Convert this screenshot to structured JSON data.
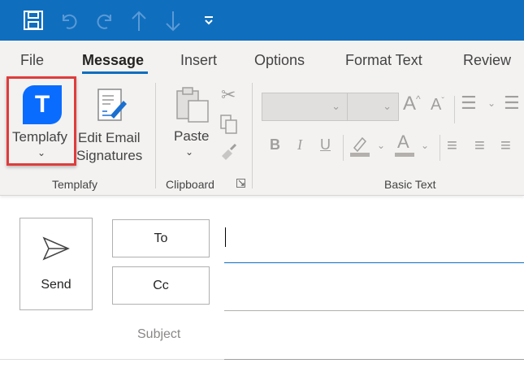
{
  "quick_access": {
    "icons": [
      "save-icon",
      "undo-icon",
      "redo-icon",
      "up-arrow-icon",
      "down-arrow-icon",
      "customize-dropdown-icon"
    ]
  },
  "tabs": [
    {
      "label": "File"
    },
    {
      "label": "Message",
      "active": true
    },
    {
      "label": "Insert"
    },
    {
      "label": "Options"
    },
    {
      "label": "Format Text"
    },
    {
      "label": "Review"
    }
  ],
  "ribbon": {
    "templafy": {
      "button": "Templafy",
      "edit_signatures_line1": "Edit Email",
      "edit_signatures_line2": "Signatures",
      "group": "Templafy",
      "logo_letter": "T"
    },
    "clipboard": {
      "paste": "Paste",
      "group": "Clipboard"
    },
    "basic_text": {
      "group": "Basic Text",
      "bold": "B",
      "italic": "I",
      "underline": "U",
      "font_color": "A"
    }
  },
  "compose": {
    "send": "Send",
    "to": "To",
    "cc": "Cc",
    "subject": "Subject",
    "to_value": "",
    "cc_value": "",
    "subject_value": ""
  },
  "colors": {
    "accent": "#106ebe",
    "templafy_blue": "#0a6cff",
    "highlight_box": "#e03c3c"
  }
}
